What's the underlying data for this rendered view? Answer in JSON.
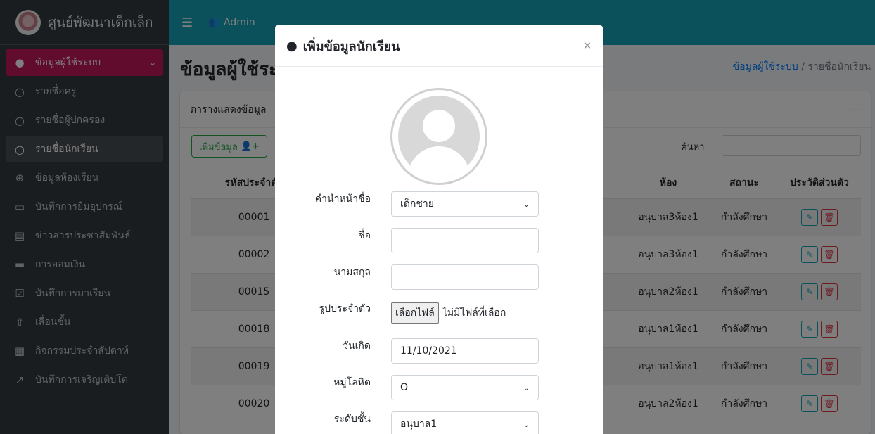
{
  "brand": {
    "title": "ศูนย์พัฒนาเด็กเล็ก"
  },
  "sidebar": {
    "items": [
      {
        "icon": "user-circle-icon",
        "label": "ข้อมูลผู้ใช้ระบบ",
        "state": "active"
      },
      {
        "icon": "circle-outline-icon",
        "label": "รายชื่อครู",
        "state": ""
      },
      {
        "icon": "circle-outline-icon",
        "label": "รายชื่อผู้ปกครอง",
        "state": ""
      },
      {
        "icon": "circle-outline-icon",
        "label": "รายชื่อนักเรียน",
        "state": "selected"
      },
      {
        "icon": "plus-circle-icon",
        "label": "ข้อมูลห้องเรียน",
        "state": ""
      },
      {
        "icon": "laptop-icon",
        "label": "บันทึกการยืมอุปกรณ์",
        "state": ""
      },
      {
        "icon": "newspaper-icon",
        "label": "ข่าวสารประชาสัมพันธ์",
        "state": ""
      },
      {
        "icon": "wallet-icon",
        "label": "การออมเงิน",
        "state": ""
      },
      {
        "icon": "calendar-check-icon",
        "label": "บันทึกการมาเรียน",
        "state": ""
      },
      {
        "icon": "arrow-up-circle-icon",
        "label": "เลื่อนชั้น",
        "state": ""
      },
      {
        "icon": "calendar-icon",
        "label": "กิจกรรมประจำสัปดาห์",
        "state": ""
      },
      {
        "icon": "chart-line-icon",
        "label": "บันทึกการเจริญเติบโต",
        "state": ""
      }
    ]
  },
  "topbar": {
    "user": "Admin"
  },
  "page": {
    "title": "ข้อมูลผู้ใช้ระบบ",
    "breadcrumb": {
      "parent": "ข้อมูลผู้ใช้ระบบ",
      "separator": "/",
      "current": "รายชื่อนักเรียน"
    }
  },
  "card": {
    "title": "ตารางแสดงข้อมูล",
    "add_button": "เพิ่มข้อมูล",
    "search_label": "ค้นหา",
    "columns": [
      "รหัสประจำตัว",
      "",
      "ห้อง",
      "สถานะ",
      "ประวัติส่วนตัว"
    ],
    "rows": [
      {
        "id": "00001",
        "room": "อนุบาล3ห้อง1",
        "status": "กำลังศึกษา"
      },
      {
        "id": "00002",
        "room": "อนุบาล3ห้อง1",
        "status": "กำลังศึกษา"
      },
      {
        "id": "00015",
        "room": "อนุบาล2ห้อง1",
        "status": "กำลังศึกษา"
      },
      {
        "id": "00018",
        "room": "อนุบาล1ห้อง1",
        "status": "กำลังศึกษา"
      },
      {
        "id": "00019",
        "room": "อนุบาล1ห้อง1",
        "status": "กำลังศึกษา"
      },
      {
        "id": "00020",
        "room": "อนุบาล2ห้อง1",
        "status": "กำลังศึกษา"
      }
    ]
  },
  "modal": {
    "title": "เพิ่มข้อมูลนักเรียน",
    "close": "×",
    "fields": {
      "prefix": {
        "label": "คำนำหน้าชื่อ",
        "value": "เด็กชาย"
      },
      "firstname": {
        "label": "ชื่อ",
        "value": ""
      },
      "lastname": {
        "label": "นามสกุล",
        "value": ""
      },
      "photo": {
        "label": "รูปประจำตัว",
        "button": "เลือกไฟล์",
        "status": "ไม่มีไฟล์ที่เลือก"
      },
      "birthdate": {
        "label": "วันเกิด",
        "value": "11/10/2021"
      },
      "blood": {
        "label": "หมู่โลหิต",
        "value": "O"
      },
      "level": {
        "label": "ระดับชั้น",
        "value": "อนุบาล1"
      }
    }
  },
  "colors": {
    "topbar": "#17a2b8",
    "sidebar": "#343a40",
    "active": "#c2185b",
    "success": "#28a745",
    "danger": "#dc3545"
  }
}
